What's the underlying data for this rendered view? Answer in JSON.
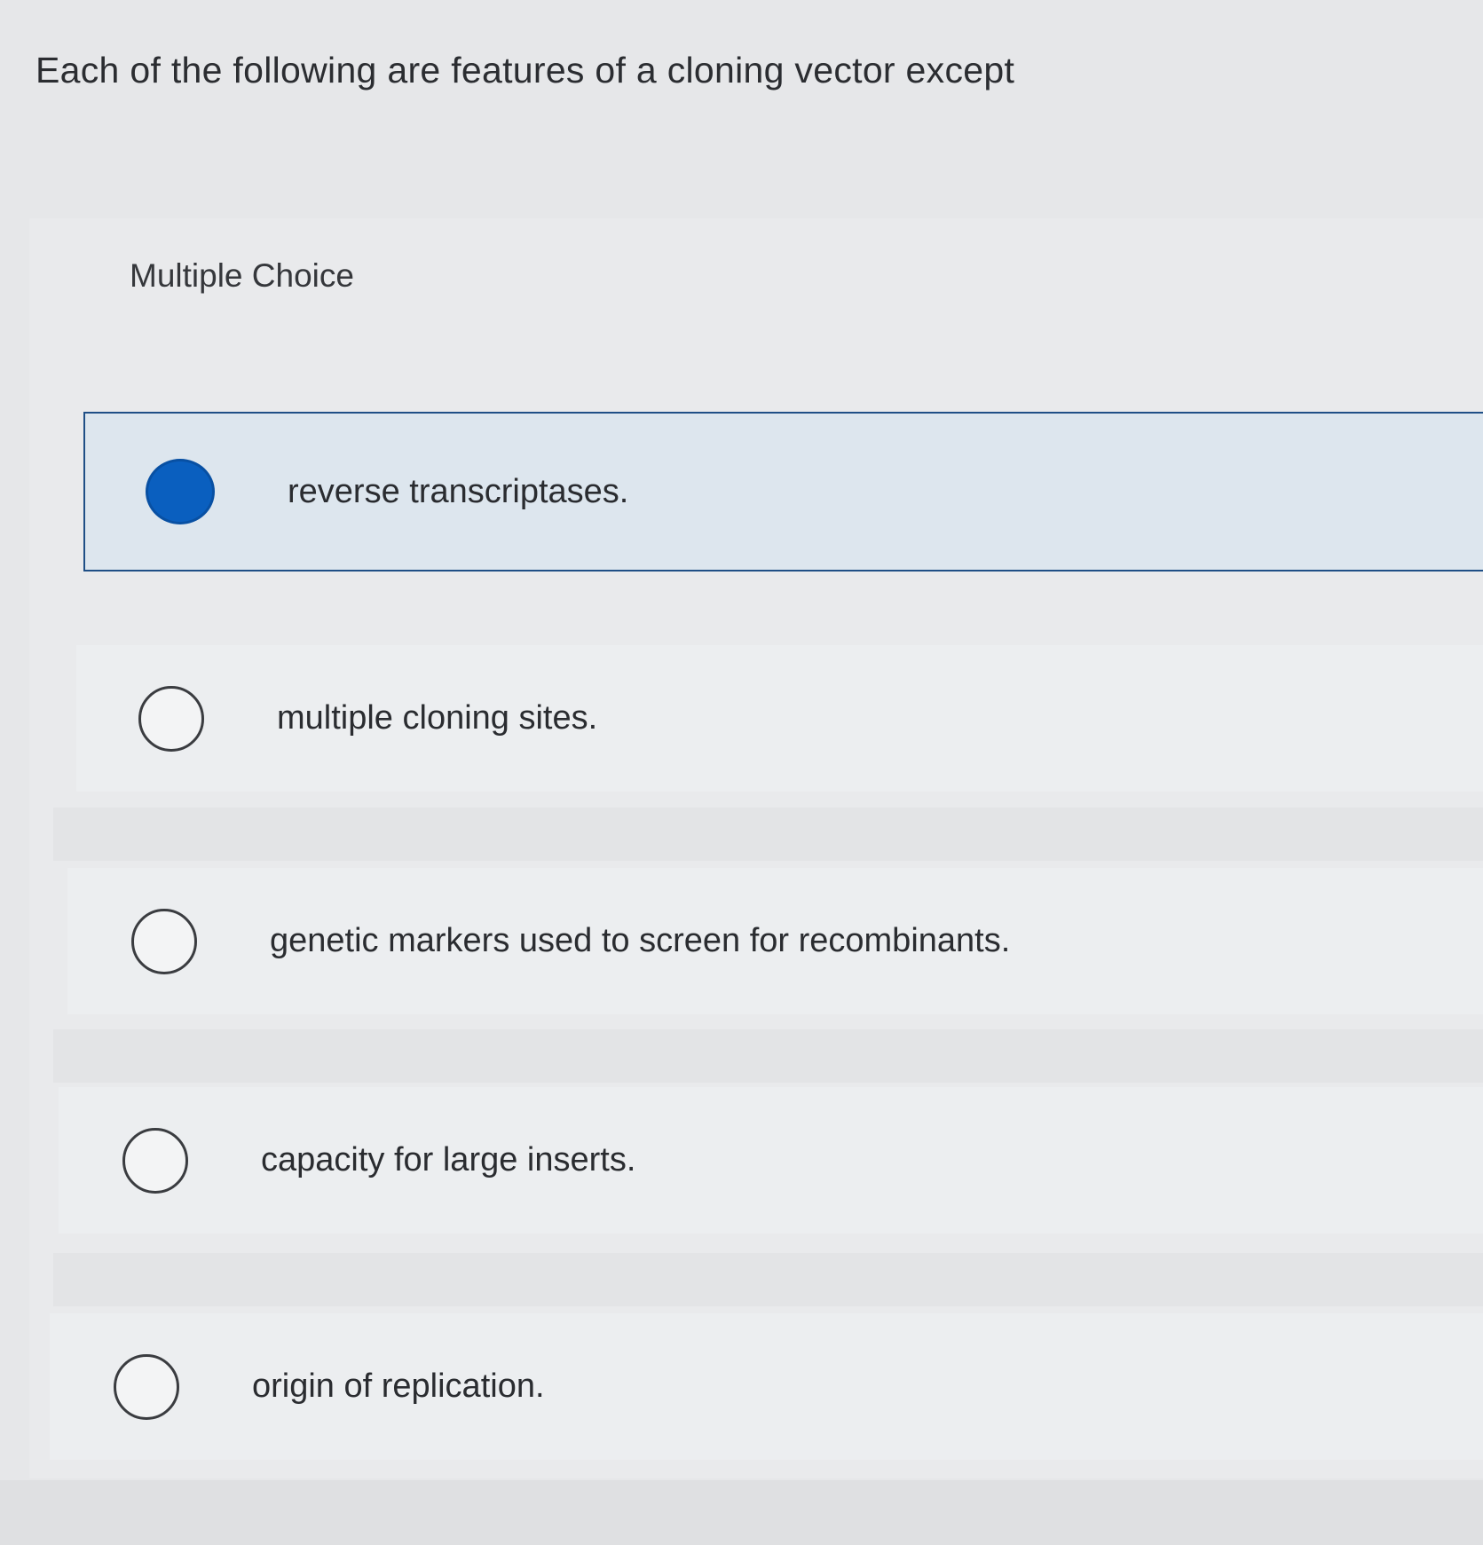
{
  "question": {
    "text": "Each of the following are features of a cloning vector except"
  },
  "quiz": {
    "type_label": "Multiple Choice",
    "options": [
      {
        "label": "reverse transcriptases.",
        "selected": true
      },
      {
        "label": "multiple cloning sites.",
        "selected": false
      },
      {
        "label": "genetic markers used to screen for recombinants.",
        "selected": false
      },
      {
        "label": "capacity for large inserts.",
        "selected": false
      },
      {
        "label": "origin of replication.",
        "selected": false
      }
    ]
  },
  "colors": {
    "selected_radio": "#0a5fbf",
    "selected_border": "#1f4f86",
    "selected_background": "#dde6ee",
    "page_background": "#e6e7e9"
  }
}
